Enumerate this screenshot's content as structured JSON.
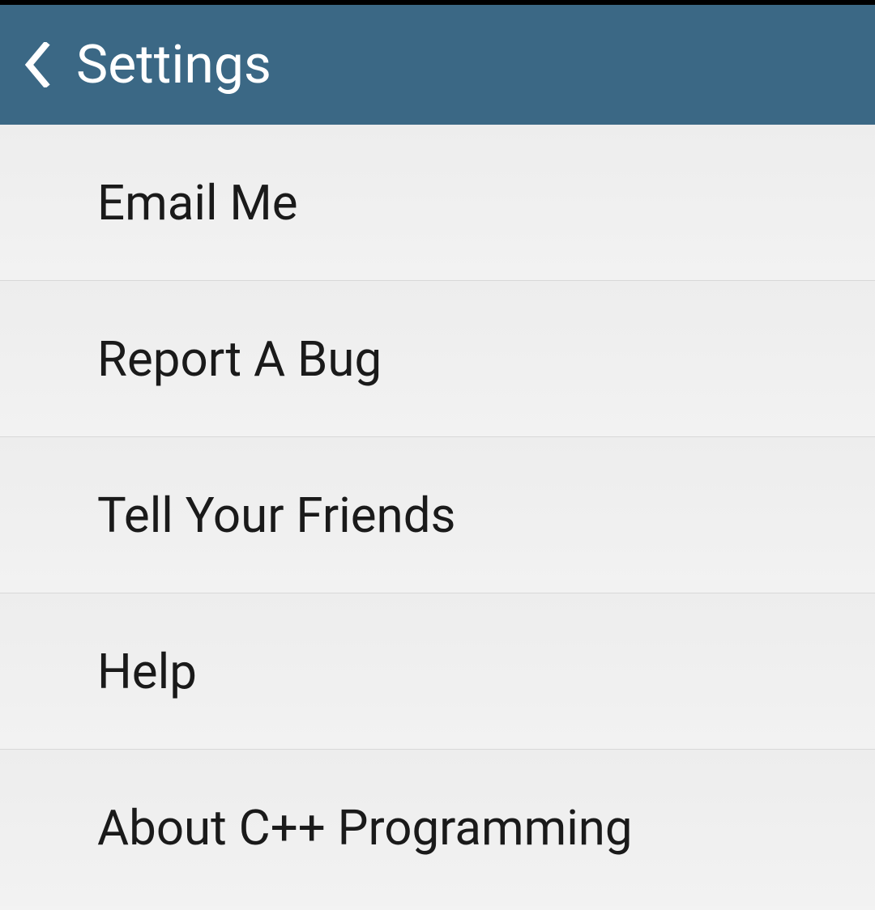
{
  "header": {
    "title": "Settings"
  },
  "list": {
    "items": [
      {
        "label": "Email Me"
      },
      {
        "label": "Report A Bug"
      },
      {
        "label": "Tell Your Friends"
      },
      {
        "label": "Help"
      },
      {
        "label": "About C++ Programming"
      }
    ]
  }
}
